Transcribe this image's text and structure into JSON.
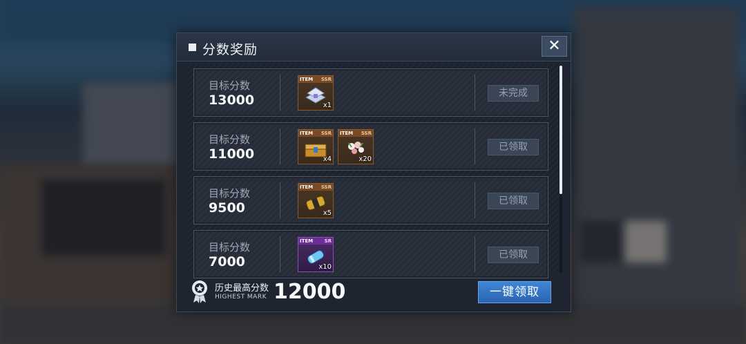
{
  "dialog": {
    "title": "分数奖励",
    "close_glyph": "✕"
  },
  "rows": [
    {
      "label": "目标分数",
      "score": "13000",
      "status": "未完成",
      "items": [
        {
          "tag": "ITEM",
          "rarity": "SSR",
          "qty": "x1",
          "icon": "silver-chest-icon"
        }
      ]
    },
    {
      "label": "目标分数",
      "score": "11000",
      "status": "已领取",
      "items": [
        {
          "tag": "ITEM",
          "rarity": "SSR",
          "qty": "x4",
          "icon": "gold-chest-icon"
        },
        {
          "tag": "ITEM",
          "rarity": "SSR",
          "qty": "x20",
          "icon": "flower-bouquet-icon"
        }
      ]
    },
    {
      "label": "目标分数",
      "score": "9500",
      "status": "已领取",
      "items": [
        {
          "tag": "ITEM",
          "rarity": "SSR",
          "qty": "x5",
          "icon": "gold-capsule-icon"
        }
      ]
    },
    {
      "label": "目标分数",
      "score": "7000",
      "status": "已领取",
      "items": [
        {
          "tag": "ITEM",
          "rarity": "SR",
          "qty": "x10",
          "icon": "blue-capsule-icon"
        }
      ]
    }
  ],
  "footer": {
    "history_cn": "历史最高分数",
    "history_en": "HIGHEST MARK",
    "history_value": "12000",
    "claim_all": "一键领取"
  },
  "colors": {
    "accent_button": "#3f86d6",
    "ssr_border": "#8b5a2b",
    "sr_border": "#8a4bb8"
  }
}
